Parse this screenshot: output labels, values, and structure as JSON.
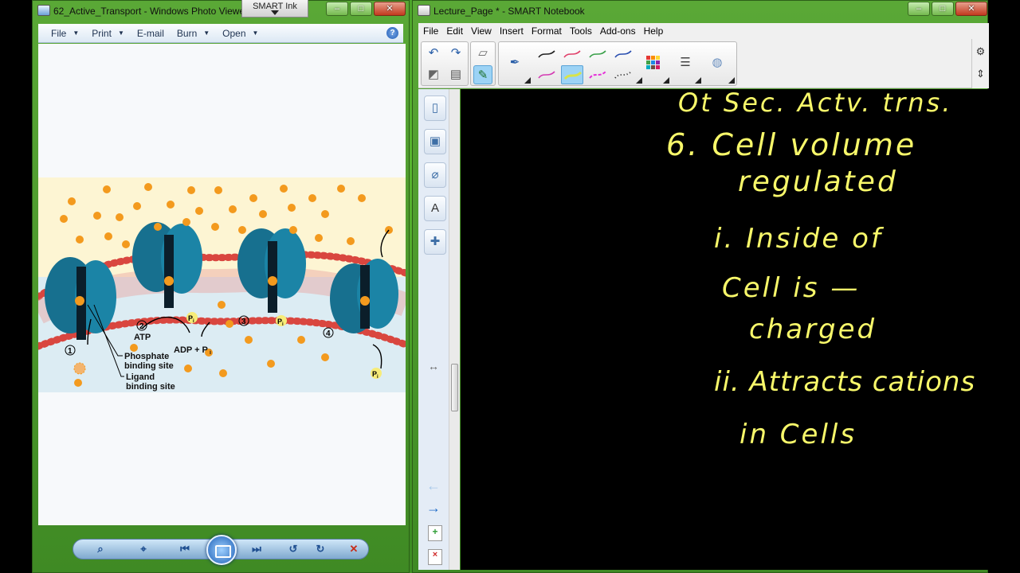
{
  "photo_viewer": {
    "title": "62_Active_Transport - Windows Photo Viewer",
    "window_buttons": {
      "minimize": "–",
      "maximize": "□",
      "close": "✕"
    },
    "menu": [
      {
        "label": "File",
        "has_caret": true
      },
      {
        "label": "Print",
        "has_caret": true
      },
      {
        "label": "E-mail",
        "has_caret": false
      },
      {
        "label": "Burn",
        "has_caret": true
      },
      {
        "label": "Open",
        "has_caret": true
      }
    ],
    "help_glyph": "?",
    "diagram": {
      "steps": [
        "1",
        "2",
        "3",
        "4"
      ],
      "labels": {
        "atp": "ATP",
        "adp": "ADP + P",
        "adp_sub": "i",
        "pi": "P",
        "pi_sub": "i",
        "phosphate_1": "Phosphate",
        "phosphate_2": "binding site",
        "ligand_1": "Ligand",
        "ligand_2": "binding site"
      },
      "colors": {
        "outside": "#fdf5d3",
        "inside": "#dcecf3",
        "protein": "#17708f",
        "ligand": "#f39a1e",
        "membrane_head": "#d9463f",
        "pi_badge": "#f7ec78"
      }
    },
    "controls": {
      "zoom": "⌕",
      "fit": "⌖",
      "previous": "⏮",
      "slideshow": "slideshow",
      "next": "⏭",
      "rotate_ccw": "↺",
      "rotate_cw": "↻",
      "delete": "✕"
    }
  },
  "smart_ink": {
    "label": "SMART Ink"
  },
  "notebook": {
    "title": "Lecture_Page * - SMART Notebook",
    "window_buttons": {
      "minimize": "–",
      "maximize": "□",
      "close": "✕"
    },
    "menu": [
      "File",
      "Edit",
      "View",
      "Insert",
      "Format",
      "Tools",
      "Add-ons",
      "Help"
    ],
    "pen_colors": [
      "#222222",
      "#e0406a",
      "#3aa04a",
      "#2a4fb0",
      "#d43bb3",
      "#d8e34a",
      "#e52fd8",
      "#222222"
    ],
    "right_toolbar": {
      "settings": "⚙",
      "move": "⇕"
    },
    "side_tabs": [
      "page-sorter",
      "gallery",
      "attachments",
      "properties",
      "add-ons"
    ],
    "side_arrows": {
      "back": "←",
      "forward": "→",
      "resize": "↔"
    },
    "ink_text": [
      "Ot Sec. Actv. trns.",
      "6. Cell volume",
      "regulated",
      "i. Inside of",
      "Cell is —",
      "charged",
      "ii. Attracts cations",
      "in Cells"
    ],
    "ink_color": "#f8f86a"
  }
}
